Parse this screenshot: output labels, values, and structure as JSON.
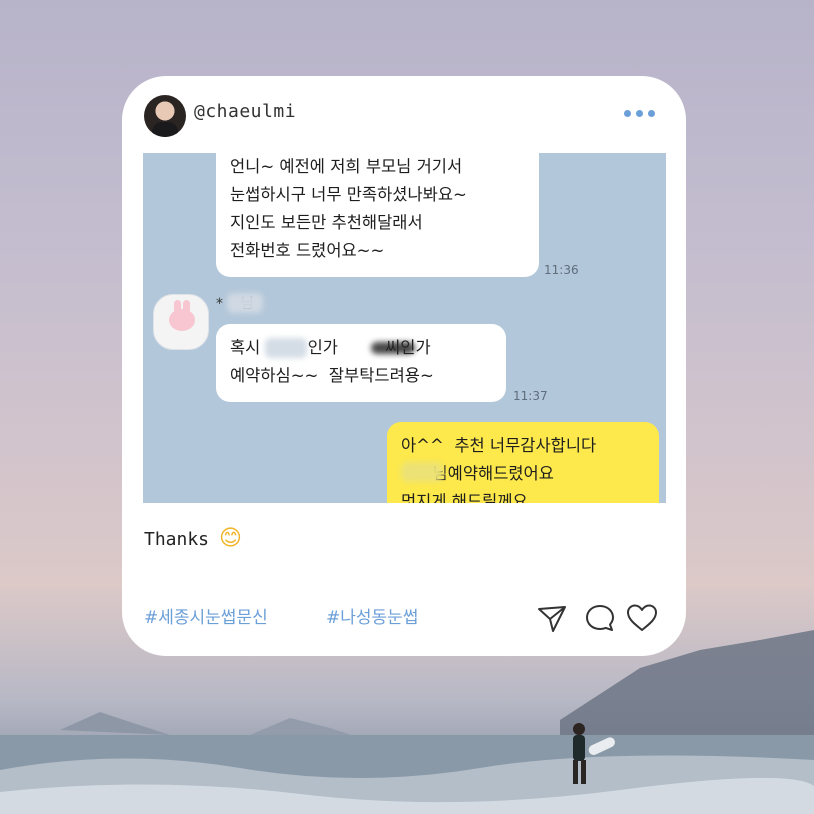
{
  "post": {
    "username": "@chaeulmi",
    "caption": "Thanks",
    "caption_emoji": "😊",
    "hashtags": [
      "#세종시눈썹문신",
      "#나성동눈썹"
    ]
  },
  "chat": {
    "messages": [
      {
        "text": "언니~ 예전에 저희 부모님 거기서\n눈썹하시구 너무 만족하셨나봐요~\n지인도 보든만 추천해달래서\n전화번호 드렸어요~~",
        "time": "11:36"
      },
      {
        "sender": "*    님",
        "text": "혹시         인가         씨인가\n예약하심~~  잘부탁드려용~",
        "time": "11:37"
      },
      {
        "text": "아^^  추천 너무감사합니다\n      님예약해드렸어요\n멋지게 해드릴께요"
      }
    ]
  },
  "icons": {
    "more": "more-dots-icon",
    "send": "send-icon",
    "comment": "comment-icon",
    "like": "heart-icon"
  },
  "colors": {
    "accent": "#6b9fd8",
    "chat_background": "#b2c7da",
    "my_bubble": "#fde94b"
  }
}
